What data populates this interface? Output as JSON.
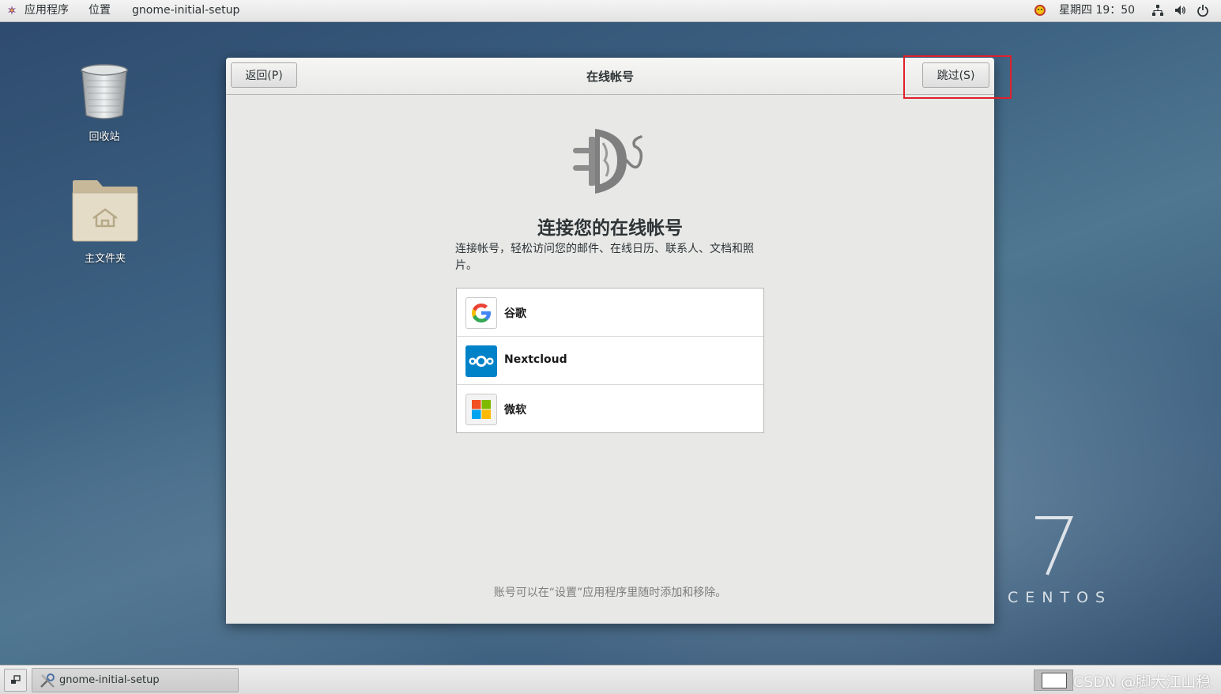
{
  "topbar": {
    "apps_label": "应用程序",
    "places_label": "位置",
    "active_app_label": "gnome-initial-setup",
    "clock": "星期四 19：50"
  },
  "desktop": {
    "trash_label": "回收站",
    "home_label": "主文件夹"
  },
  "dialog": {
    "back_button": "返回(P)",
    "title": "在线帐号",
    "skip_button": "跳过(S)",
    "heading": "连接您的在线帐号",
    "description": "连接帐号，轻松访问您的邮件、在线日历、联系人、文档和照片。",
    "providers": [
      {
        "name": "谷歌",
        "icon": "google-icon"
      },
      {
        "name": "Nextcloud",
        "icon": "nextcloud-icon"
      },
      {
        "name": "微软",
        "icon": "microsoft-icon"
      }
    ],
    "footer_note": "账号可以在“设置”应用程序里随时添加和移除。"
  },
  "branding": {
    "version": "7",
    "name": "CENTOS"
  },
  "taskbar": {
    "task_label": "gnome-initial-setup",
    "watermark": "CSDN @脚大江山稳"
  },
  "colors": {
    "highlight": "#e1202a",
    "nextcloud_blue": "#0082c9",
    "dialog_bg": "#e8e8e7"
  }
}
